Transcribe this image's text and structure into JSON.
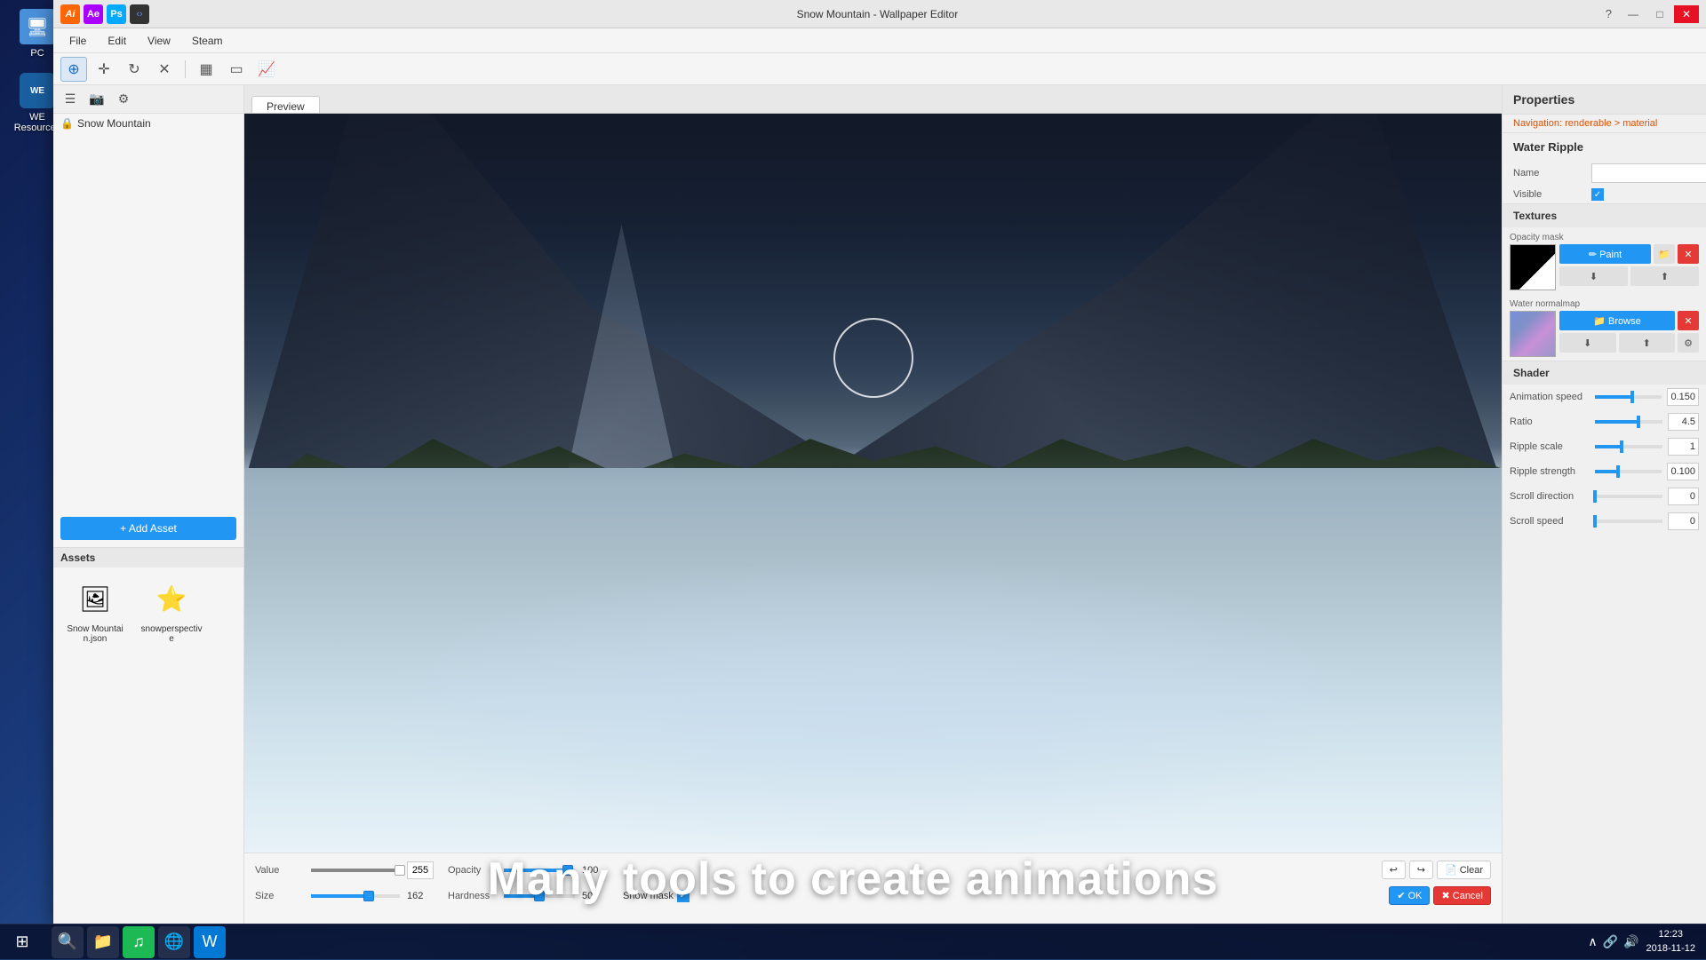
{
  "window": {
    "title": "Snow Mountain - Wallpaper Editor"
  },
  "menu": {
    "items": [
      "File",
      "Edit",
      "View",
      "Steam"
    ]
  },
  "toolbar": {
    "buttons": [
      "⊕",
      "✛",
      "↻",
      "✕",
      "▦",
      "▭",
      "📈"
    ]
  },
  "left_panel": {
    "tree_item": "Snow Mountain",
    "add_asset_label": "+ Add Asset",
    "assets_header": "Assets",
    "assets": [
      {
        "label": "Snow Mountain.json",
        "icon": "🖼"
      },
      {
        "label": "snowperspective",
        "icon": "⭐"
      }
    ]
  },
  "preview": {
    "tab_label": "Preview"
  },
  "bottom_controls": {
    "value_label": "Value",
    "value_num": "255",
    "opacity_label": "Opacity",
    "opacity_num": "100",
    "size_label": "Size",
    "size_num": "162",
    "hardness_label": "Hardness",
    "hardness_num": "50",
    "show_mask_label": "Show mask",
    "clear_label": "Clear",
    "ok_label": "✔ OK",
    "cancel_label": "✖ Cancel"
  },
  "properties": {
    "header": "Properties",
    "nav_text": "Navigation: ",
    "nav_path": "renderable > material",
    "section_title": "Water Ripple",
    "name_label": "Name",
    "visible_label": "Visible",
    "textures_header": "Textures",
    "opacity_mask_label": "Opacity mask",
    "water_normalmap_label": "Water normalmap",
    "paint_label": "✏ Paint",
    "browse_label": "📁 Browse",
    "shader_header": "Shader",
    "shader_props": [
      {
        "label": "Animation speed",
        "value": "0.150",
        "percent": 55
      },
      {
        "label": "Ratio",
        "value": "4.5",
        "percent": 65
      },
      {
        "label": "Ripple scale",
        "value": "1",
        "percent": 40
      },
      {
        "label": "Ripple strength",
        "value": "0.100",
        "percent": 35
      },
      {
        "label": "Scroll direction",
        "value": "0",
        "percent": 0
      },
      {
        "label": "Scroll speed",
        "value": "0",
        "percent": 0
      }
    ]
  },
  "overlay": {
    "text": "Many tools to create animations"
  },
  "taskbar": {
    "time": "12:23",
    "date": "2018-11-12"
  },
  "desktop_apps": [
    {
      "label": "PC",
      "color": "#4a90d9"
    },
    {
      "label": "WE Resources",
      "color": "#2196f3"
    }
  ]
}
